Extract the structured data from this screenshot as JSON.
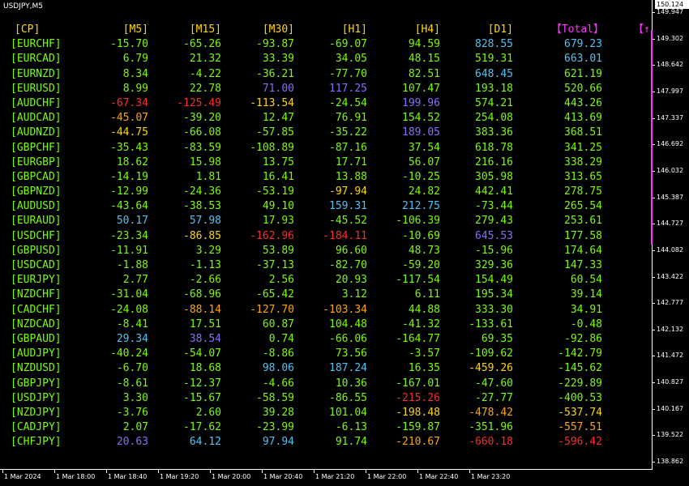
{
  "window": {
    "symbol_title": "USDJPY,M5"
  },
  "colors": {
    "header": "#ffd700",
    "total_header": "#ff33ff",
    "pair": "#7cfc00",
    "green": "#7cfc00",
    "lightblue": "#4fc3f7",
    "purple": "#8a6cff",
    "yellow": "#ffd700",
    "orange": "#ffa500",
    "red": "#ff2a2a",
    "blue": "#3aa0ff",
    "axis": "#ffffff",
    "bg": "#000000"
  },
  "table": {
    "headers": [
      "[CP]",
      "[M5]",
      "[M15]",
      "[M30]",
      "[H1]",
      "[H4]",
      "[D1]",
      "【Total】",
      "【↑"
    ],
    "rows": [
      {
        "pair": "[EURCHF]",
        "values": [
          "-15.70",
          "-65.26",
          "-93.87",
          "-69.07",
          "94.59",
          "828.55",
          "679.23"
        ],
        "colors": [
          "green",
          "green",
          "green",
          "green",
          "green",
          "lightblue",
          "lightblue"
        ]
      },
      {
        "pair": "[EURCAD]",
        "values": [
          "6.79",
          "21.32",
          "33.39",
          "34.05",
          "48.15",
          "519.31",
          "663.01"
        ],
        "colors": [
          "green",
          "green",
          "green",
          "green",
          "green",
          "green",
          "lightblue"
        ]
      },
      {
        "pair": "[EURNZD]",
        "values": [
          "8.34",
          "-4.22",
          "-36.21",
          "-77.70",
          "82.51",
          "648.45",
          "621.19"
        ],
        "colors": [
          "green",
          "green",
          "green",
          "green",
          "green",
          "lightblue",
          "green"
        ]
      },
      {
        "pair": "[EURUSD]",
        "values": [
          "8.99",
          "22.78",
          "71.00",
          "117.25",
          "107.47",
          "193.18",
          "520.66"
        ],
        "colors": [
          "green",
          "green",
          "purple",
          "purple",
          "green",
          "green",
          "green"
        ]
      },
      {
        "pair": "[AUDCHF]",
        "values": [
          "-67.34",
          "-125.49",
          "-113.54",
          "-24.54",
          "199.96",
          "574.21",
          "443.26"
        ],
        "colors": [
          "red",
          "red",
          "yellow",
          "green",
          "purple",
          "green",
          "green"
        ]
      },
      {
        "pair": "[AUDCAD]",
        "values": [
          "-45.07",
          "-39.20",
          "12.47",
          "76.91",
          "154.52",
          "254.08",
          "413.69"
        ],
        "colors": [
          "orange",
          "green",
          "green",
          "green",
          "green",
          "green",
          "green"
        ]
      },
      {
        "pair": "[AUDNZD]",
        "values": [
          "-44.75",
          "-66.08",
          "-57.85",
          "-35.22",
          "189.05",
          "383.36",
          "368.51"
        ],
        "colors": [
          "yellow",
          "green",
          "green",
          "green",
          "purple",
          "green",
          "green"
        ]
      },
      {
        "pair": "[GBPCHF]",
        "values": [
          "-35.43",
          "-83.59",
          "-108.89",
          "-87.16",
          "37.54",
          "618.78",
          "341.25"
        ],
        "colors": [
          "green",
          "green",
          "green",
          "green",
          "green",
          "green",
          "green"
        ]
      },
      {
        "pair": "[EURGBP]",
        "values": [
          "18.62",
          "15.98",
          "13.75",
          "17.71",
          "56.07",
          "216.16",
          "338.29"
        ],
        "colors": [
          "green",
          "green",
          "green",
          "green",
          "green",
          "green",
          "green"
        ]
      },
      {
        "pair": "[GBPCAD]",
        "values": [
          "-14.19",
          "1.81",
          "16.41",
          "13.88",
          "-10.25",
          "305.98",
          "313.65"
        ],
        "colors": [
          "green",
          "green",
          "green",
          "green",
          "green",
          "green",
          "green"
        ]
      },
      {
        "pair": "[GBPNZD]",
        "values": [
          "-12.99",
          "-24.36",
          "-53.19",
          "-97.94",
          "24.82",
          "442.41",
          "278.75"
        ],
        "colors": [
          "green",
          "green",
          "green",
          "yellow",
          "green",
          "green",
          "green"
        ]
      },
      {
        "pair": "[AUDUSD]",
        "values": [
          "-43.64",
          "-38.53",
          "49.10",
          "159.31",
          "212.75",
          "-73.44",
          "265.54"
        ],
        "colors": [
          "green",
          "green",
          "green",
          "lightblue",
          "lightblue",
          "green",
          "green"
        ]
      },
      {
        "pair": "[EURAUD]",
        "values": [
          "50.17",
          "57.98",
          "17.93",
          "-45.52",
          "-106.39",
          "279.43",
          "253.61"
        ],
        "colors": [
          "lightblue",
          "lightblue",
          "green",
          "green",
          "green",
          "green",
          "green"
        ]
      },
      {
        "pair": "[USDCHF]",
        "values": [
          "-23.34",
          "-86.85",
          "-162.96",
          "-184.11",
          "-10.69",
          "645.53",
          "177.58"
        ],
        "colors": [
          "green",
          "yellow",
          "red",
          "red",
          "green",
          "purple",
          "green"
        ]
      },
      {
        "pair": "[GBPUSD]",
        "values": [
          "-11.91",
          "3.29",
          "53.89",
          "96.60",
          "48.73",
          "-15.96",
          "174.64"
        ],
        "colors": [
          "green",
          "green",
          "green",
          "green",
          "green",
          "green",
          "green"
        ]
      },
      {
        "pair": "[USDCAD]",
        "values": [
          "-1.88",
          "-1.13",
          "-37.13",
          "-82.70",
          "-59.20",
          "329.36",
          "147.33"
        ],
        "colors": [
          "green",
          "green",
          "green",
          "green",
          "green",
          "green",
          "green"
        ]
      },
      {
        "pair": "[EURJPY]",
        "values": [
          "2.77",
          "-2.66",
          "2.56",
          "20.93",
          "-117.54",
          "154.49",
          "60.54"
        ],
        "colors": [
          "green",
          "green",
          "green",
          "green",
          "green",
          "green",
          "green"
        ]
      },
      {
        "pair": "[NZDCHF]",
        "values": [
          "-31.04",
          "-68.96",
          "-65.42",
          "3.12",
          "6.11",
          "195.34",
          "39.14"
        ],
        "colors": [
          "green",
          "green",
          "green",
          "green",
          "green",
          "green",
          "green"
        ]
      },
      {
        "pair": "[CADCHF]",
        "values": [
          "-24.08",
          "-88.14",
          "-127.70",
          "-103.34",
          "44.88",
          "333.30",
          "34.91"
        ],
        "colors": [
          "green",
          "orange",
          "orange",
          "orange",
          "green",
          "green",
          "green"
        ]
      },
      {
        "pair": "[NZDCAD]",
        "values": [
          "-8.41",
          "17.51",
          "60.87",
          "104.48",
          "-41.32",
          "-133.61",
          "-0.48"
        ],
        "colors": [
          "green",
          "green",
          "green",
          "green",
          "green",
          "green",
          "green"
        ]
      },
      {
        "pair": "[GBPAUD]",
        "values": [
          "29.34",
          "38.54",
          "0.74",
          "-66.06",
          "-164.77",
          "69.35",
          "-92.86"
        ],
        "colors": [
          "lightblue",
          "purple",
          "green",
          "green",
          "green",
          "green",
          "green"
        ]
      },
      {
        "pair": "[AUDJPY]",
        "values": [
          "-40.24",
          "-54.07",
          "-8.86",
          "73.56",
          "-3.57",
          "-109.62",
          "-142.79"
        ],
        "colors": [
          "green",
          "green",
          "green",
          "green",
          "green",
          "green",
          "green"
        ]
      },
      {
        "pair": "[NZDUSD]",
        "values": [
          "-6.70",
          "18.68",
          "98.06",
          "187.24",
          "16.35",
          "-459.26",
          "-145.62"
        ],
        "colors": [
          "green",
          "green",
          "lightblue",
          "lightblue",
          "green",
          "yellow",
          "green"
        ]
      },
      {
        "pair": "[GBPJPY]",
        "values": [
          "-8.61",
          "-12.37",
          "-4.66",
          "10.36",
          "-167.01",
          "-47.60",
          "-229.89"
        ],
        "colors": [
          "green",
          "green",
          "green",
          "green",
          "green",
          "green",
          "green"
        ]
      },
      {
        "pair": "[USDJPY]",
        "values": [
          "3.30",
          "-15.67",
          "-58.59",
          "-86.55",
          "-215.26",
          "-27.77",
          "-400.53"
        ],
        "colors": [
          "green",
          "green",
          "green",
          "green",
          "red",
          "green",
          "green"
        ]
      },
      {
        "pair": "[NZDJPY]",
        "values": [
          "-3.76",
          "2.60",
          "39.28",
          "101.04",
          "-198.48",
          "-478.42",
          "-537.74"
        ],
        "colors": [
          "green",
          "green",
          "green",
          "green",
          "yellow",
          "orange",
          "yellow"
        ]
      },
      {
        "pair": "[CADJPY]",
        "values": [
          "2.07",
          "-17.62",
          "-23.99",
          "-6.13",
          "-159.87",
          "-351.96",
          "-557.51"
        ],
        "colors": [
          "green",
          "green",
          "green",
          "green",
          "green",
          "green",
          "orange"
        ]
      },
      {
        "pair": "[CHFJPY]",
        "values": [
          "20.63",
          "64.12",
          "97.94",
          "91.74",
          "-210.67",
          "-660.18",
          "-596.42"
        ],
        "colors": [
          "purple",
          "lightblue",
          "lightblue",
          "green",
          "orange",
          "red",
          "red"
        ]
      }
    ]
  },
  "price_axis": {
    "current": "150.124",
    "labels": [
      "149.947",
      "149.302",
      "148.642",
      "147.997",
      "147.337",
      "146.692",
      "146.032",
      "145.387",
      "144.727",
      "144.082",
      "143.422",
      "142.777",
      "142.132",
      "141.472",
      "140.827",
      "140.167",
      "139.522",
      "138.862"
    ]
  },
  "time_axis": {
    "labels": [
      "1 Mar 2024",
      "1 Mar 18:00",
      "1 Mar 18:40",
      "1 Mar 19:20",
      "1 Mar 20:00",
      "1 Mar 20:40",
      "1 Mar 21:20",
      "1 Mar 22:00",
      "1 Mar 22:40",
      "1 Mar 23:20"
    ]
  }
}
